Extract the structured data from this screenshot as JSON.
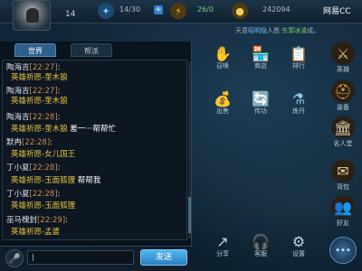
{
  "topbar": {
    "level": "14",
    "energy": "14/30",
    "stamina": "26/0",
    "coins": "242094",
    "logo": "网易CC"
  },
  "broadcast": {
    "prefix": "天意",
    "highlight": "昭明隐",
    "middle": "人愿·",
    "green": "东郭冰凌",
    "suffix": "成。"
  },
  "chat": {
    "tabs": [
      "世界",
      "帮派"
    ],
    "messages": [
      {
        "name": "陶海吉",
        "time": "[22:27]",
        "text": "英雄祈愿-奎木狼",
        "extra": ""
      },
      {
        "name": "陶海吉",
        "time": "[22:27]",
        "text": "英雄祈愿-奎木狼",
        "extra": ""
      },
      {
        "name": "陶海吉",
        "time": "[22:28]",
        "text": "英雄祈愿-奎木狼",
        "extra": " 差一···帮帮忙"
      },
      {
        "name": "默冉",
        "time": "[22:28]",
        "text": "英雄祈愿-女儿国王",
        "extra": ""
      },
      {
        "name": "丁小夏",
        "time": "[22:28]",
        "text": "英雄祈愿-玉面狐狸",
        "extra": " 帮帮我"
      },
      {
        "name": "丁小夏",
        "time": "[22:28]",
        "text": "英雄祈愿-玉面狐狸",
        "extra": ""
      },
      {
        "name": "巫马槐封",
        "time": "[22:29]",
        "text": "英雄祈愿-孟婆",
        "extra": ""
      }
    ],
    "input_value": "|",
    "send_label": "发送"
  },
  "functions": {
    "row1": [
      "召唤",
      "商店",
      "排行"
    ],
    "row2": [
      "出售",
      "传功",
      "炼丹"
    ],
    "row3": [
      "分享",
      "客服",
      "设置"
    ]
  },
  "side": [
    "英雄",
    "装备",
    "名人堂",
    "背包",
    "好友"
  ],
  "colors": {
    "accent": "#2f7fd0",
    "gold_text": "#e8c23c",
    "time_text": "#d08a4c"
  }
}
